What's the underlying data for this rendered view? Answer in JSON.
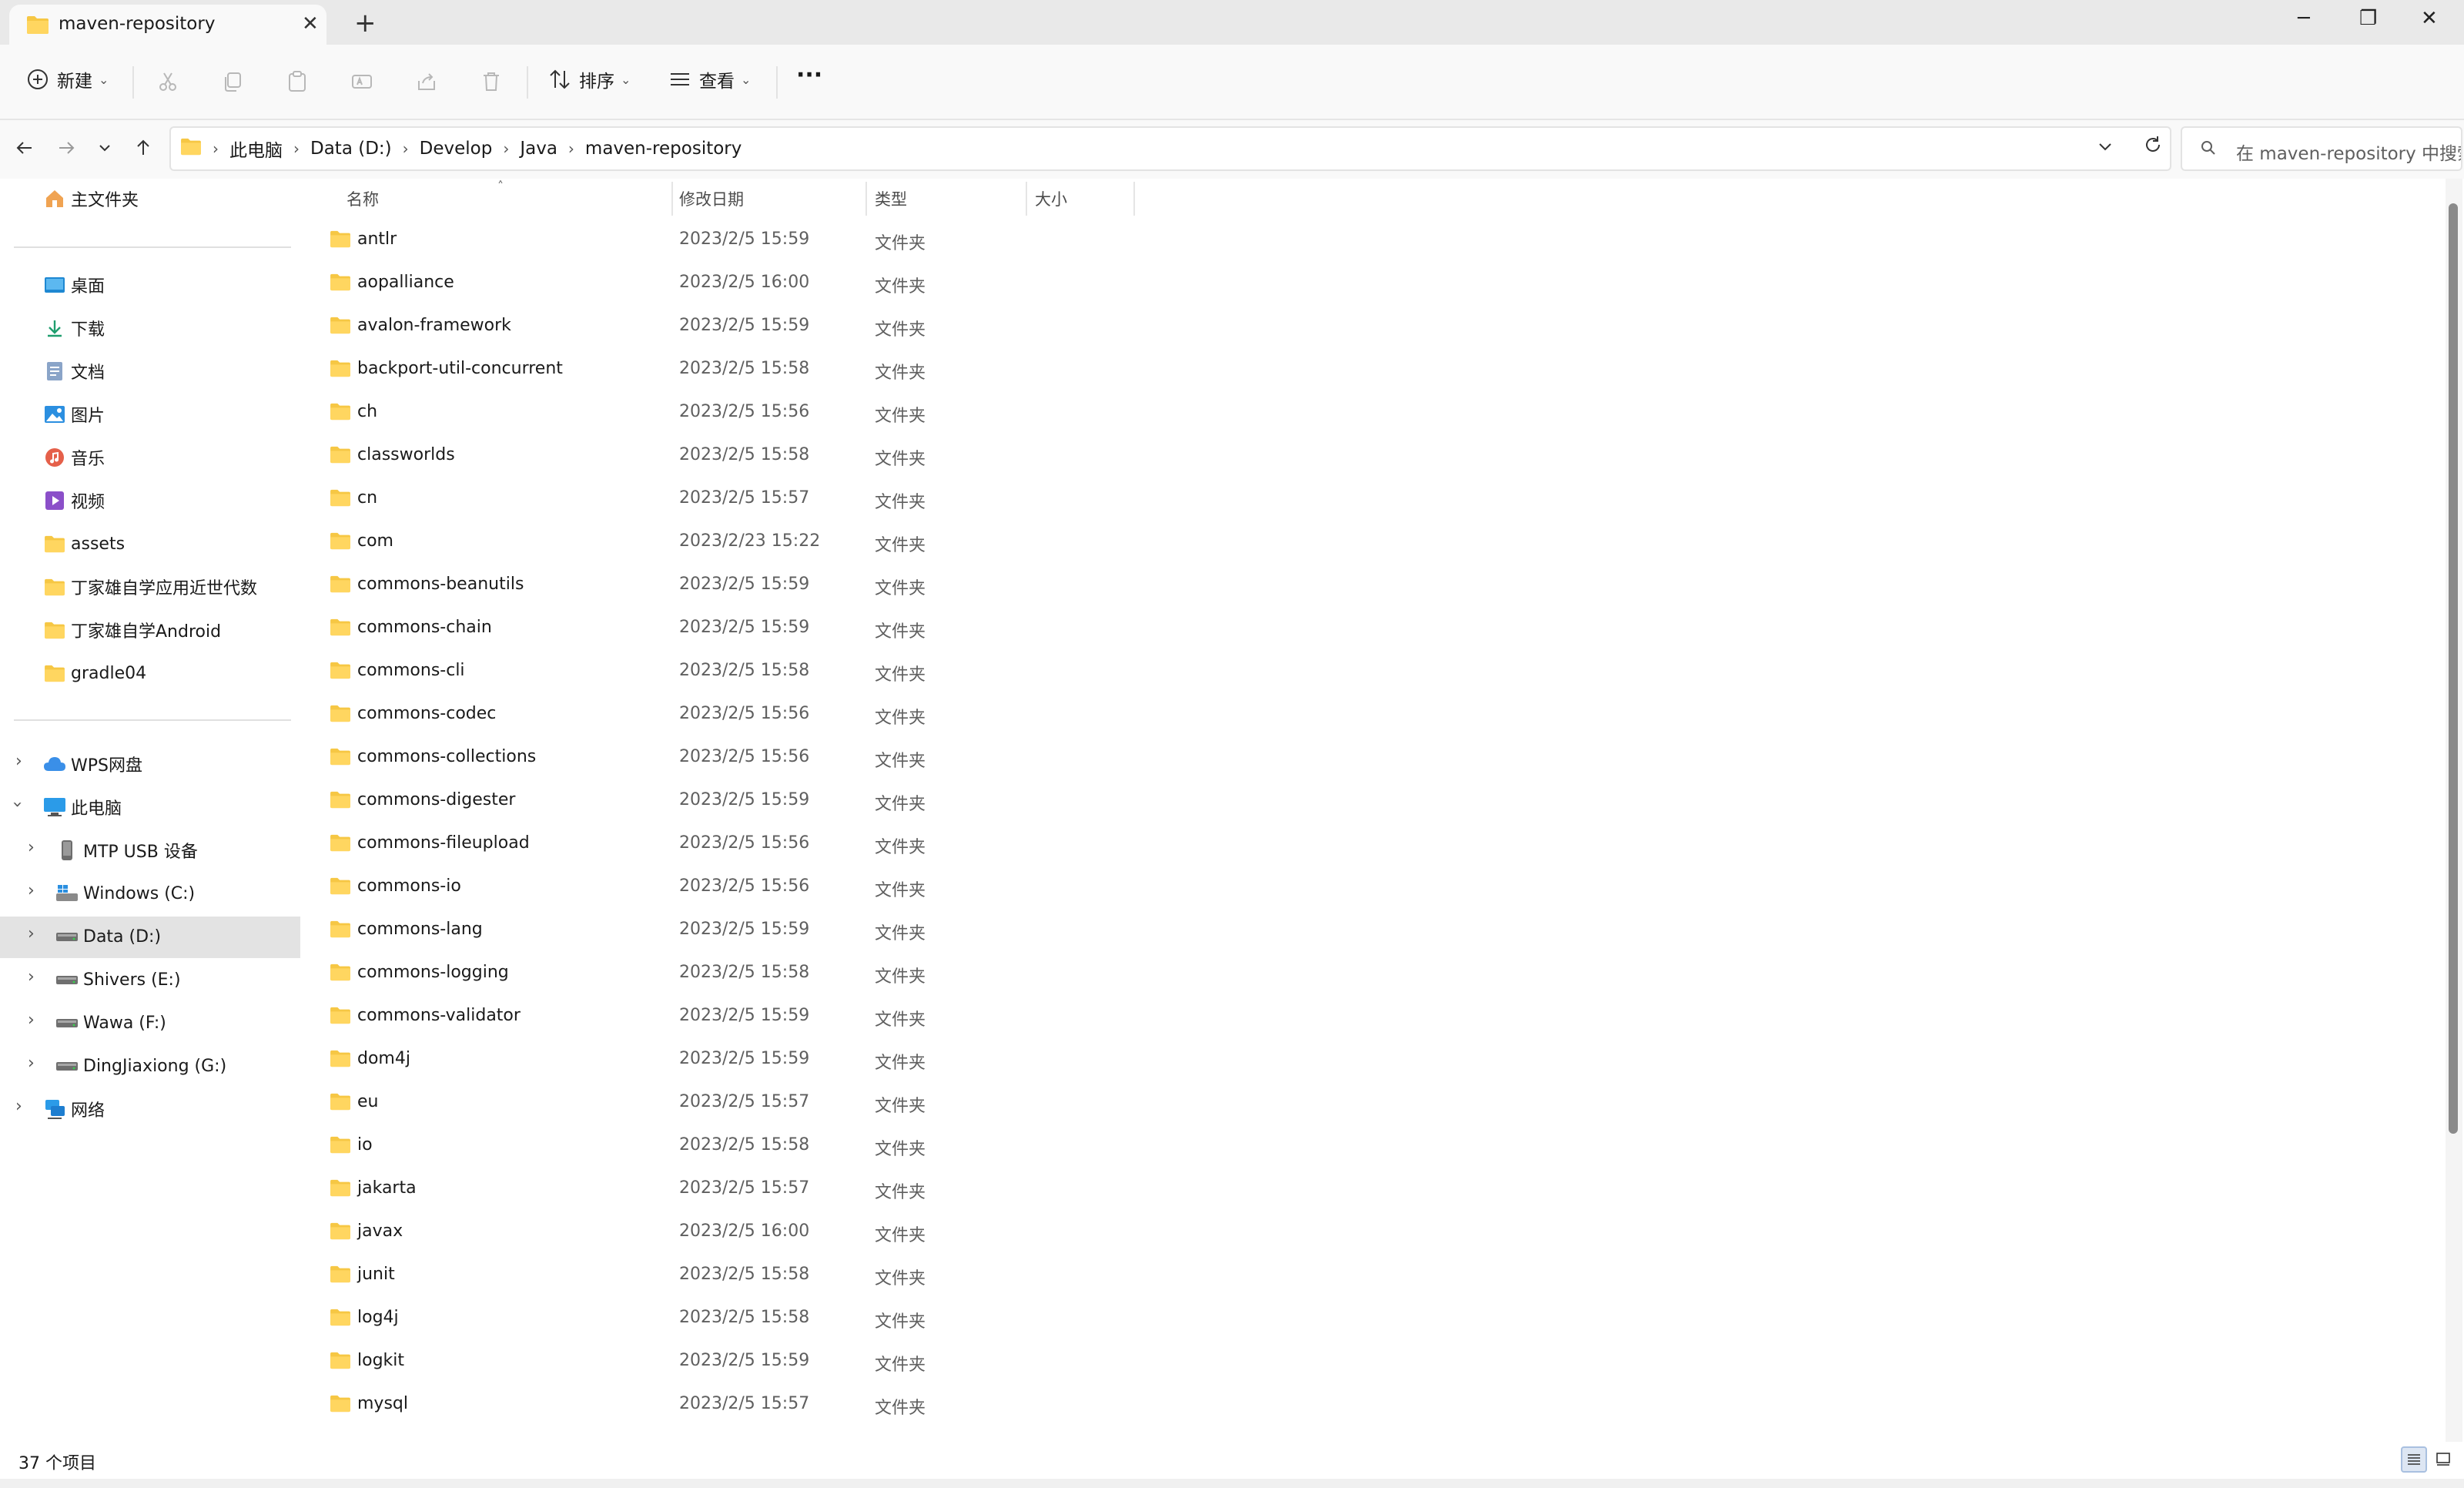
{
  "window": {
    "tab_title": "maven-repository",
    "tab_close": "✕",
    "new_tab": "+",
    "minimize": "─",
    "restore": "❐",
    "close": "✕"
  },
  "toolbar": {
    "new_label": "新建",
    "sort_label": "排序",
    "view_label": "查看",
    "more_label": "···",
    "icons": [
      "cut-icon",
      "copy-icon",
      "paste-icon",
      "rename-icon",
      "share-icon",
      "delete-icon"
    ]
  },
  "address_bar": {
    "breadcrumbs": [
      "此电脑",
      "Data (D:)",
      "Develop",
      "Java",
      "maven-repository"
    ],
    "breadcrumb_sep": "›"
  },
  "search": {
    "placeholder": "在 maven-repository 中搜索"
  },
  "sidebar": {
    "home": "主文件夹",
    "quick_access": [
      {
        "label": "桌面",
        "icon": "desktop-icon",
        "pinned": true
      },
      {
        "label": "下载",
        "icon": "download-icon",
        "pinned": true
      },
      {
        "label": "文档",
        "icon": "document-icon",
        "pinned": true
      },
      {
        "label": "图片",
        "icon": "picture-icon",
        "pinned": true
      },
      {
        "label": "音乐",
        "icon": "music-icon",
        "pinned": true
      },
      {
        "label": "视频",
        "icon": "video-icon",
        "pinned": true
      },
      {
        "label": "assets",
        "icon": "folder-icon",
        "pinned": false
      },
      {
        "label": "丁家雄自学应用近世代数",
        "icon": "folder-icon",
        "pinned": false
      },
      {
        "label": "丁家雄自学Android",
        "icon": "folder-icon",
        "pinned": false
      },
      {
        "label": "gradle04",
        "icon": "folder-icon",
        "pinned": false
      }
    ],
    "tree": [
      {
        "label": "WPS网盘",
        "icon": "cloud-icon",
        "expanded": false
      },
      {
        "label": "此电脑",
        "icon": "computer-icon",
        "expanded": true
      },
      {
        "label": "MTP USB 设备",
        "icon": "usb-device-icon",
        "expanded": false
      },
      {
        "label": "Windows (C:)",
        "icon": "windows-drive-icon",
        "expanded": false
      },
      {
        "label": "Data (D:)",
        "icon": "drive-icon",
        "expanded": false,
        "selected": true
      },
      {
        "label": "Shivers (E:)",
        "icon": "drive-icon",
        "expanded": false
      },
      {
        "label": "Wawa (F:)",
        "icon": "drive-icon",
        "expanded": false
      },
      {
        "label": "DingJiaxiong (G:)",
        "icon": "drive-icon",
        "expanded": false
      },
      {
        "label": "网络",
        "icon": "network-icon",
        "expanded": false
      }
    ]
  },
  "columns": {
    "name": "名称",
    "date": "修改日期",
    "type": "类型",
    "size": "大小"
  },
  "files": [
    {
      "name": "antlr",
      "date": "2023/2/5 15:59",
      "type": "文件夹"
    },
    {
      "name": "aopalliance",
      "date": "2023/2/5 16:00",
      "type": "文件夹"
    },
    {
      "name": "avalon-framework",
      "date": "2023/2/5 15:59",
      "type": "文件夹"
    },
    {
      "name": "backport-util-concurrent",
      "date": "2023/2/5 15:58",
      "type": "文件夹"
    },
    {
      "name": "ch",
      "date": "2023/2/5 15:56",
      "type": "文件夹"
    },
    {
      "name": "classworlds",
      "date": "2023/2/5 15:58",
      "type": "文件夹"
    },
    {
      "name": "cn",
      "date": "2023/2/5 15:57",
      "type": "文件夹"
    },
    {
      "name": "com",
      "date": "2023/2/23 15:22",
      "type": "文件夹"
    },
    {
      "name": "commons-beanutils",
      "date": "2023/2/5 15:59",
      "type": "文件夹"
    },
    {
      "name": "commons-chain",
      "date": "2023/2/5 15:59",
      "type": "文件夹"
    },
    {
      "name": "commons-cli",
      "date": "2023/2/5 15:58",
      "type": "文件夹"
    },
    {
      "name": "commons-codec",
      "date": "2023/2/5 15:56",
      "type": "文件夹"
    },
    {
      "name": "commons-collections",
      "date": "2023/2/5 15:56",
      "type": "文件夹"
    },
    {
      "name": "commons-digester",
      "date": "2023/2/5 15:59",
      "type": "文件夹"
    },
    {
      "name": "commons-fileupload",
      "date": "2023/2/5 15:56",
      "type": "文件夹"
    },
    {
      "name": "commons-io",
      "date": "2023/2/5 15:56",
      "type": "文件夹"
    },
    {
      "name": "commons-lang",
      "date": "2023/2/5 15:59",
      "type": "文件夹"
    },
    {
      "name": "commons-logging",
      "date": "2023/2/5 15:58",
      "type": "文件夹"
    },
    {
      "name": "commons-validator",
      "date": "2023/2/5 15:59",
      "type": "文件夹"
    },
    {
      "name": "dom4j",
      "date": "2023/2/5 15:59",
      "type": "文件夹"
    },
    {
      "name": "eu",
      "date": "2023/2/5 15:57",
      "type": "文件夹"
    },
    {
      "name": "io",
      "date": "2023/2/5 15:58",
      "type": "文件夹"
    },
    {
      "name": "jakarta",
      "date": "2023/2/5 15:57",
      "type": "文件夹"
    },
    {
      "name": "javax",
      "date": "2023/2/5 16:00",
      "type": "文件夹"
    },
    {
      "name": "junit",
      "date": "2023/2/5 15:58",
      "type": "文件夹"
    },
    {
      "name": "log4j",
      "date": "2023/2/5 15:58",
      "type": "文件夹"
    },
    {
      "name": "logkit",
      "date": "2023/2/5 15:59",
      "type": "文件夹"
    },
    {
      "name": "mysql",
      "date": "2023/2/5 15:57",
      "type": "文件夹"
    }
  ],
  "status": {
    "item_count": "37 个项目"
  },
  "colors": {
    "folder": "#f6c744",
    "folder_dark": "#e9a823",
    "selected_bg": "#e3e3e3",
    "accent": "#0067c0"
  }
}
